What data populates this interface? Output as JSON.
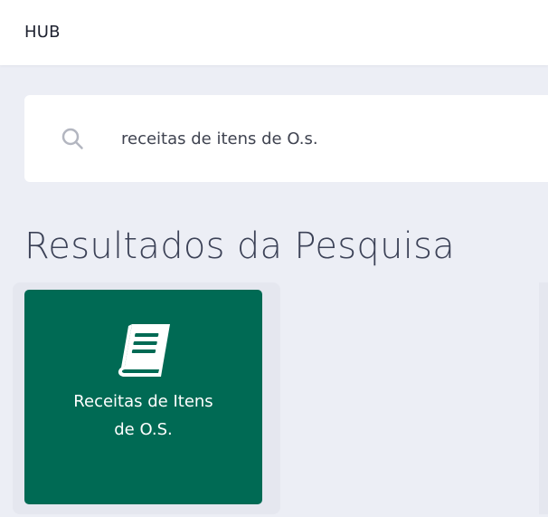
{
  "header": {
    "title": "HUB"
  },
  "search": {
    "value": "receitas de itens de O.s.",
    "icon": "search-icon"
  },
  "results": {
    "heading": "Resultados da Pesquisa",
    "cards": [
      {
        "label": "Receitas de Itens de O.S.",
        "icon": "book-icon",
        "color": "#006a54"
      }
    ]
  },
  "colors": {
    "background": "#eceef5",
    "surface": "#ffffff",
    "accent": "#006a54",
    "text": "#3c4257",
    "icon_muted": "#b3b6c0"
  }
}
